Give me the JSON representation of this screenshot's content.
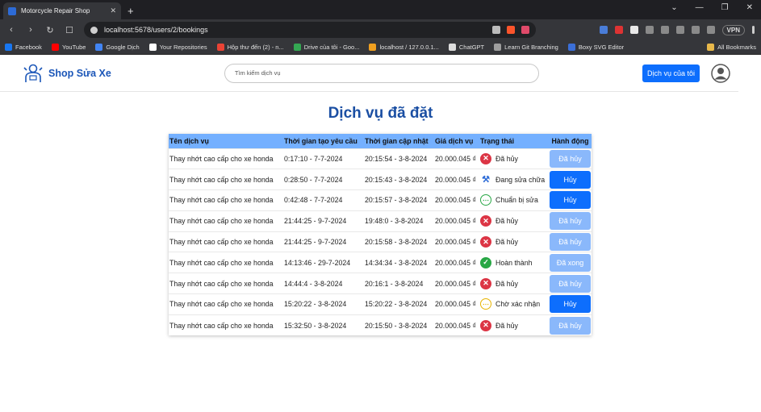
{
  "browser": {
    "tab_title": "Motorcycle Repair Shop",
    "url": "localhost:5678/users/2/bookings",
    "vpn_label": "VPN",
    "bookmarks": [
      {
        "label": "Facebook",
        "color": "#1877f2"
      },
      {
        "label": "YouTube",
        "color": "#ff0000"
      },
      {
        "label": "Google Dịch",
        "color": "#4285f4"
      },
      {
        "label": "Your Repositories",
        "color": "#ffffff"
      },
      {
        "label": "Hộp thư đến (2) - n...",
        "color": "#ea4335"
      },
      {
        "label": "Drive của tôi - Goo...",
        "color": "#34a853"
      },
      {
        "label": "localhost / 127.0.0.1...",
        "color": "#f0a020"
      },
      {
        "label": "ChatGPT",
        "color": "#dddddd"
      },
      {
        "label": "Learn Git Branching",
        "color": "#9e9e9e"
      },
      {
        "label": "Boxy SVG Editor",
        "color": "#3b6fd8"
      }
    ],
    "all_bookmarks": "All Bookmarks"
  },
  "navbar": {
    "brand": "Shop Sửa Xe",
    "search_placeholder": "Tìm kiếm dịch vụ",
    "services_button": "Dịch vụ của tôi"
  },
  "page_title": "Dịch vụ đã đặt",
  "table": {
    "headers": [
      "Tên dịch vụ",
      "Thời gian tạo yêu cầu",
      "Thời gian cập nhật",
      "Giá dịch vụ",
      "Trạng thái",
      "Hành động"
    ],
    "rows": [
      {
        "name": "Thay nhớt cao cấp cho xe honda",
        "created": "0:17:10 - 7-7-2024",
        "updated": "20:15:54 - 3-8-2024",
        "price": "20.000.045 ₫",
        "status": "Đã hủy",
        "status_type": "cancel",
        "action": "Đã hủy",
        "action_enabled": false
      },
      {
        "name": "Thay nhớt cao cấp cho xe honda",
        "created": "0:28:50 - 7-7-2024",
        "updated": "20:15:43 - 3-8-2024",
        "price": "20.000.045 ₫",
        "status": "Đang sửa chữa",
        "status_type": "fix",
        "action": "Hủy",
        "action_enabled": true
      },
      {
        "name": "Thay nhớt cao cấp cho xe honda",
        "created": "0:42:48 - 7-7-2024",
        "updated": "20:15:57 - 3-8-2024",
        "price": "20.000.045 ₫",
        "status": "Chuẩn bị sửa",
        "status_type": "prep",
        "action": "Hủy",
        "action_enabled": true
      },
      {
        "name": "Thay nhớt cao cấp cho xe honda",
        "created": "21:44:25 - 9-7-2024",
        "updated": "19:48:0 - 3-8-2024",
        "price": "20.000.045 ₫",
        "status": "Đã hủy",
        "status_type": "cancel",
        "action": "Đã hủy",
        "action_enabled": false
      },
      {
        "name": "Thay nhớt cao cấp cho xe honda",
        "created": "21:44:25 - 9-7-2024",
        "updated": "20:15:58 - 3-8-2024",
        "price": "20.000.045 ₫",
        "status": "Đã hủy",
        "status_type": "cancel",
        "action": "Đã hủy",
        "action_enabled": false
      },
      {
        "name": "Thay nhớt cao cấp cho xe honda",
        "created": "14:13:46 - 29-7-2024",
        "updated": "14:34:34 - 3-8-2024",
        "price": "20.000.045 ₫",
        "status": "Hoàn thành",
        "status_type": "done",
        "action": "Đã xong",
        "action_enabled": false
      },
      {
        "name": "Thay nhớt cao cấp cho xe honda",
        "created": "14:44:4 - 3-8-2024",
        "updated": "20:16:1 - 3-8-2024",
        "price": "20.000.045 ₫",
        "status": "Đã hủy",
        "status_type": "cancel",
        "action": "Đã hủy",
        "action_enabled": false
      },
      {
        "name": "Thay nhớt cao cấp cho xe honda",
        "created": "15:20:22 - 3-8-2024",
        "updated": "15:20:22 - 3-8-2024",
        "price": "20.000.045 ₫",
        "status": "Chờ xác nhận",
        "status_type": "wait",
        "action": "Hủy",
        "action_enabled": true
      },
      {
        "name": "Thay nhớt cao cấp cho xe honda",
        "created": "15:32:50 - 3-8-2024",
        "updated": "20:15:50 - 3-8-2024",
        "price": "20.000.045 ₫",
        "status": "Đã hủy",
        "status_type": "cancel",
        "action": "Đã hủy",
        "action_enabled": false
      }
    ]
  },
  "colors": {
    "primary": "#0d6efd",
    "header_bg": "#74b0ff",
    "title": "#1b4fa3",
    "cancel": "#dc3545",
    "done": "#28a745"
  }
}
